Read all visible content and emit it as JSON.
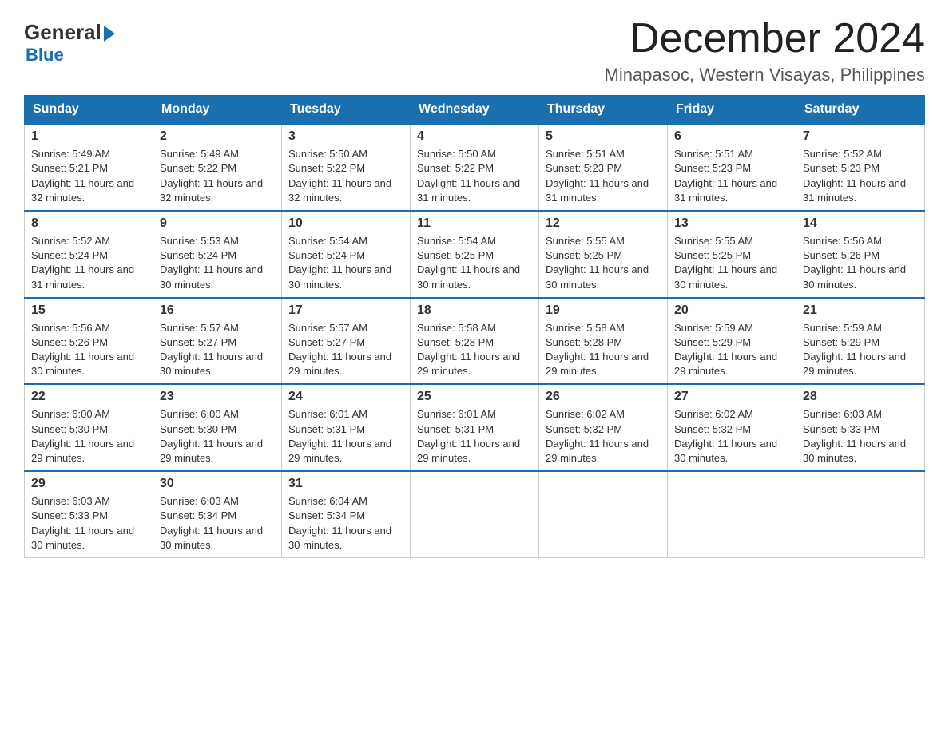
{
  "logo": {
    "general": "General",
    "blue": "Blue"
  },
  "header": {
    "month_year": "December 2024",
    "location": "Minapasoc, Western Visayas, Philippines"
  },
  "weekdays": [
    "Sunday",
    "Monday",
    "Tuesday",
    "Wednesday",
    "Thursday",
    "Friday",
    "Saturday"
  ],
  "weeks": [
    [
      {
        "day": "1",
        "sunrise": "5:49 AM",
        "sunset": "5:21 PM",
        "daylight": "11 hours and 32 minutes."
      },
      {
        "day": "2",
        "sunrise": "5:49 AM",
        "sunset": "5:22 PM",
        "daylight": "11 hours and 32 minutes."
      },
      {
        "day": "3",
        "sunrise": "5:50 AM",
        "sunset": "5:22 PM",
        "daylight": "11 hours and 32 minutes."
      },
      {
        "day": "4",
        "sunrise": "5:50 AM",
        "sunset": "5:22 PM",
        "daylight": "11 hours and 31 minutes."
      },
      {
        "day": "5",
        "sunrise": "5:51 AM",
        "sunset": "5:23 PM",
        "daylight": "11 hours and 31 minutes."
      },
      {
        "day": "6",
        "sunrise": "5:51 AM",
        "sunset": "5:23 PM",
        "daylight": "11 hours and 31 minutes."
      },
      {
        "day": "7",
        "sunrise": "5:52 AM",
        "sunset": "5:23 PM",
        "daylight": "11 hours and 31 minutes."
      }
    ],
    [
      {
        "day": "8",
        "sunrise": "5:52 AM",
        "sunset": "5:24 PM",
        "daylight": "11 hours and 31 minutes."
      },
      {
        "day": "9",
        "sunrise": "5:53 AM",
        "sunset": "5:24 PM",
        "daylight": "11 hours and 30 minutes."
      },
      {
        "day": "10",
        "sunrise": "5:54 AM",
        "sunset": "5:24 PM",
        "daylight": "11 hours and 30 minutes."
      },
      {
        "day": "11",
        "sunrise": "5:54 AM",
        "sunset": "5:25 PM",
        "daylight": "11 hours and 30 minutes."
      },
      {
        "day": "12",
        "sunrise": "5:55 AM",
        "sunset": "5:25 PM",
        "daylight": "11 hours and 30 minutes."
      },
      {
        "day": "13",
        "sunrise": "5:55 AM",
        "sunset": "5:25 PM",
        "daylight": "11 hours and 30 minutes."
      },
      {
        "day": "14",
        "sunrise": "5:56 AM",
        "sunset": "5:26 PM",
        "daylight": "11 hours and 30 minutes."
      }
    ],
    [
      {
        "day": "15",
        "sunrise": "5:56 AM",
        "sunset": "5:26 PM",
        "daylight": "11 hours and 30 minutes."
      },
      {
        "day": "16",
        "sunrise": "5:57 AM",
        "sunset": "5:27 PM",
        "daylight": "11 hours and 30 minutes."
      },
      {
        "day": "17",
        "sunrise": "5:57 AM",
        "sunset": "5:27 PM",
        "daylight": "11 hours and 29 minutes."
      },
      {
        "day": "18",
        "sunrise": "5:58 AM",
        "sunset": "5:28 PM",
        "daylight": "11 hours and 29 minutes."
      },
      {
        "day": "19",
        "sunrise": "5:58 AM",
        "sunset": "5:28 PM",
        "daylight": "11 hours and 29 minutes."
      },
      {
        "day": "20",
        "sunrise": "5:59 AM",
        "sunset": "5:29 PM",
        "daylight": "11 hours and 29 minutes."
      },
      {
        "day": "21",
        "sunrise": "5:59 AM",
        "sunset": "5:29 PM",
        "daylight": "11 hours and 29 minutes."
      }
    ],
    [
      {
        "day": "22",
        "sunrise": "6:00 AM",
        "sunset": "5:30 PM",
        "daylight": "11 hours and 29 minutes."
      },
      {
        "day": "23",
        "sunrise": "6:00 AM",
        "sunset": "5:30 PM",
        "daylight": "11 hours and 29 minutes."
      },
      {
        "day": "24",
        "sunrise": "6:01 AM",
        "sunset": "5:31 PM",
        "daylight": "11 hours and 29 minutes."
      },
      {
        "day": "25",
        "sunrise": "6:01 AM",
        "sunset": "5:31 PM",
        "daylight": "11 hours and 29 minutes."
      },
      {
        "day": "26",
        "sunrise": "6:02 AM",
        "sunset": "5:32 PM",
        "daylight": "11 hours and 29 minutes."
      },
      {
        "day": "27",
        "sunrise": "6:02 AM",
        "sunset": "5:32 PM",
        "daylight": "11 hours and 30 minutes."
      },
      {
        "day": "28",
        "sunrise": "6:03 AM",
        "sunset": "5:33 PM",
        "daylight": "11 hours and 30 minutes."
      }
    ],
    [
      {
        "day": "29",
        "sunrise": "6:03 AM",
        "sunset": "5:33 PM",
        "daylight": "11 hours and 30 minutes."
      },
      {
        "day": "30",
        "sunrise": "6:03 AM",
        "sunset": "5:34 PM",
        "daylight": "11 hours and 30 minutes."
      },
      {
        "day": "31",
        "sunrise": "6:04 AM",
        "sunset": "5:34 PM",
        "daylight": "11 hours and 30 minutes."
      },
      null,
      null,
      null,
      null
    ]
  ]
}
